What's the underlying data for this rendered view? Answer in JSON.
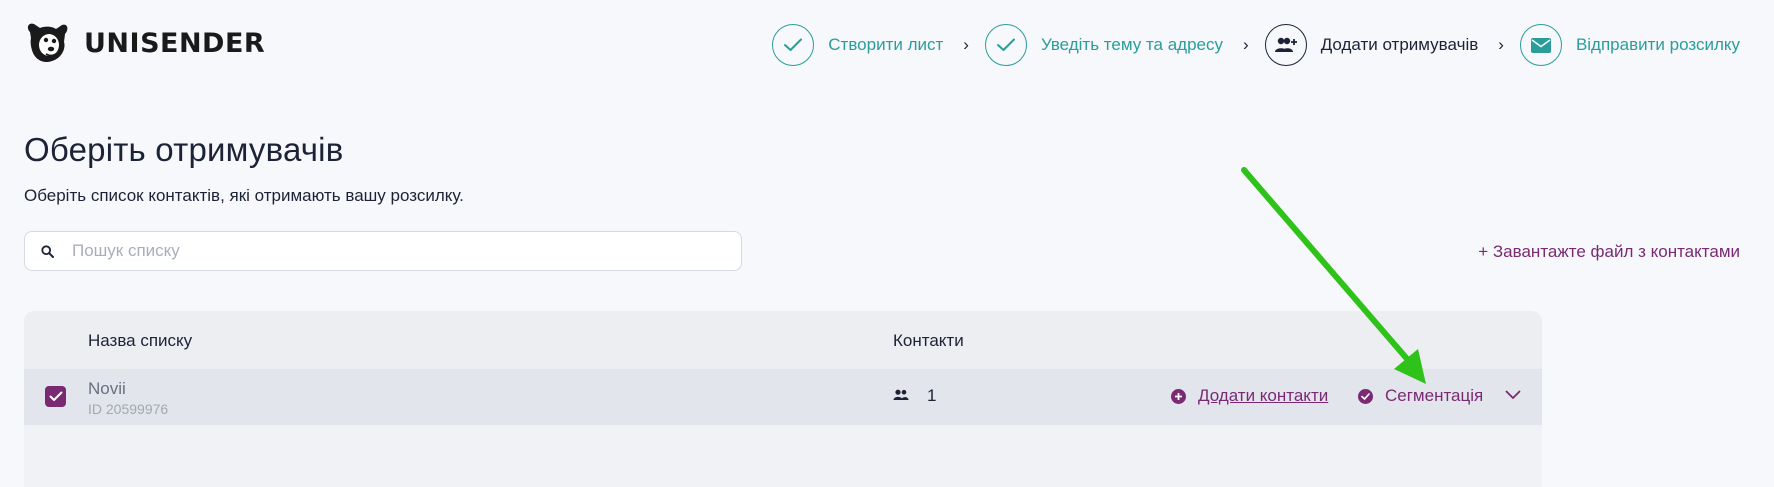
{
  "brand": {
    "name": "UNISENDER",
    "logo_icon": "dog-logo-icon"
  },
  "stepper": {
    "steps": [
      {
        "label": "Створити лист",
        "state": "done",
        "icon": "check-icon"
      },
      {
        "label": "Уведіть тему та адресу",
        "state": "done",
        "icon": "check-icon"
      },
      {
        "label": "Додати отримувачів",
        "state": "current",
        "icon": "add-users-icon"
      },
      {
        "label": "Відправити розсилку",
        "state": "upcoming",
        "icon": "envelope-icon"
      }
    ],
    "separator": "›"
  },
  "main": {
    "title": "Оберіть отримувачів",
    "subtitle": "Оберіть список контактів, які отримають вашу розсилку.",
    "search": {
      "placeholder": "Пошук списку",
      "value": ""
    },
    "upload_link": "+ Завантажте файл з контактами"
  },
  "table": {
    "headers": {
      "name": "Назва списку",
      "contacts": "Контакти"
    },
    "rows": [
      {
        "checked": true,
        "name": "Novii",
        "id": "ID 20599976",
        "contacts": "1",
        "add_contacts": "Додати контакти",
        "segmentation": "Сегментація"
      }
    ]
  },
  "colors": {
    "accent_teal": "#2a9d9a",
    "accent_purple": "#7a2a73",
    "annotation_arrow": "#2fc21a",
    "background": "#f6f8fc"
  }
}
